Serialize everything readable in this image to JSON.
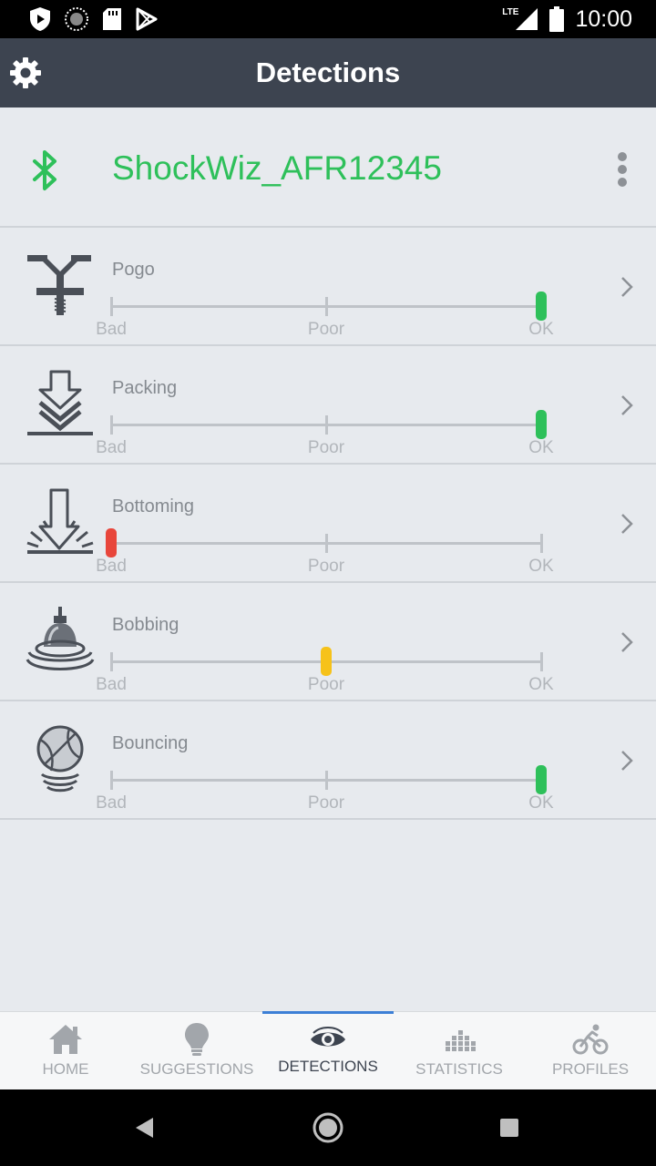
{
  "status_bar": {
    "time": "10:00",
    "network": "LTE",
    "icons": [
      "shield-icon",
      "sync-icon",
      "sd-card-icon",
      "play-store-icon",
      "signal-icon",
      "battery-icon"
    ]
  },
  "app_bar": {
    "title": "Detections",
    "settings_icon": "gear-icon"
  },
  "device": {
    "name": "ShockWiz_AFR12345",
    "name_color": "#2ec05a",
    "icon": "bluetooth-icon",
    "menu_icon": "more-vert-icon"
  },
  "scale_labels": {
    "bad": "Bad",
    "poor": "Poor",
    "ok": "OK"
  },
  "detections": [
    {
      "label": "Pogo",
      "icon": "pogo-stick-icon",
      "level": 1.0,
      "status_color": "#2ec05a"
    },
    {
      "label": "Packing",
      "icon": "packing-arrows-icon",
      "level": 1.0,
      "status_color": "#2ec05a"
    },
    {
      "label": "Bottoming",
      "icon": "bottoming-arrow-icon",
      "level": 0.0,
      "status_color": "#e8463b"
    },
    {
      "label": "Bobbing",
      "icon": "bobbing-buoy-icon",
      "level": 0.5,
      "status_color": "#f6c21a"
    },
    {
      "label": "Bouncing",
      "icon": "bouncing-ball-icon",
      "level": 1.0,
      "status_color": "#2ec05a"
    }
  ],
  "bottom_nav": {
    "active": "detections",
    "accent_color": "#3c7fd6",
    "tabs": [
      {
        "id": "home",
        "label": "HOME",
        "icon": "home-icon"
      },
      {
        "id": "suggestions",
        "label": "SUGGESTIONS",
        "icon": "lightbulb-icon"
      },
      {
        "id": "detections",
        "label": "DETECTIONS",
        "icon": "eye-icon"
      },
      {
        "id": "statistics",
        "label": "STATISTICS",
        "icon": "bar-chart-icon"
      },
      {
        "id": "profiles",
        "label": "PROFILES",
        "icon": "cyclist-icon"
      }
    ]
  },
  "system_nav": {
    "icons": [
      "back-icon",
      "home-circle-icon",
      "recents-icon"
    ]
  }
}
